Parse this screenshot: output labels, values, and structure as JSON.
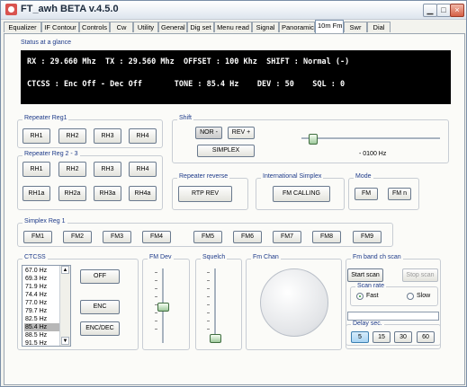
{
  "window": {
    "title": "FT_awh BETA v.4.5.0"
  },
  "tabs": [
    "Equalizer",
    "IF Contour",
    "Controls",
    "Cw",
    "Utility",
    "General",
    "Dig set",
    "Menu read",
    "Signal",
    "Panoramic",
    "10m Fm",
    "Swr",
    "Dial"
  ],
  "active_tab": "10m Fm",
  "status": {
    "label": "Status at a glance",
    "line1": "RX : 29.660 Mhz  TX : 29.560 Mhz  OFFSET : 100 Khz  SHIFT : Normal (-)",
    "line2": "CTCSS : Enc Off - Dec Off       TONE : 85.4 Hz    DEV : 50    SQL : 0"
  },
  "repeater1": {
    "label": "Repeater Reg1",
    "buttons": [
      "RH1",
      "RH2",
      "RH3",
      "RH4"
    ]
  },
  "repeater23": {
    "label": "Repeater Reg 2 - 3",
    "row1": [
      "RH1",
      "RH2",
      "RH3",
      "RH4"
    ],
    "row2": [
      "RH1a",
      "RH2a",
      "RH3a",
      "RH4a"
    ]
  },
  "shift": {
    "label": "Shift",
    "nor": "NOR -",
    "rev": "REV +",
    "simplex": "SIMPLEX",
    "offset": "- 0100 Hz"
  },
  "reverse": {
    "label": "Repeater reverse",
    "button": "RTP REV"
  },
  "intl": {
    "label": "International Simplex",
    "button": "FM CALLING"
  },
  "mode": {
    "label": "Mode",
    "fm": "FM",
    "fmn": "FM n"
  },
  "simplex": {
    "label": "Simplex Reg 1",
    "buttons": [
      "FM1",
      "FM2",
      "FM3",
      "FM4",
      "FM5",
      "FM6",
      "FM7",
      "FM8",
      "FM9"
    ]
  },
  "ctcss": {
    "label": "CTCSS",
    "list": [
      "67.0 Hz",
      "69.3 Hz",
      "71.9 Hz",
      "74.4 Hz",
      "77.0 Hz",
      "79.7 Hz",
      "82.5 Hz",
      "85.4 Hz",
      "88.5 Hz",
      "91.5 Hz"
    ],
    "selected": "85.4 Hz",
    "off": "OFF",
    "enc": "ENC",
    "encdec": "ENC/DEC"
  },
  "fm_dev": {
    "label": "FM Dev"
  },
  "squelch": {
    "label": "Squelch"
  },
  "fm_chan": {
    "label": "Fm Chan"
  },
  "scan": {
    "label": "Fm band ch scan",
    "start": "Start scan",
    "stop": "Stop scan",
    "rate_label": "Scan rate",
    "fast": "Fast",
    "slow": "Slow",
    "delay_label": "Delay sec.",
    "delays": [
      "5",
      "15",
      "30",
      "60"
    ],
    "selected_delay": "5"
  },
  "colors": {
    "display_bg": "#000000",
    "groupbox_label": "#1e3b8a",
    "slider_thumb": "#9ec99c"
  }
}
